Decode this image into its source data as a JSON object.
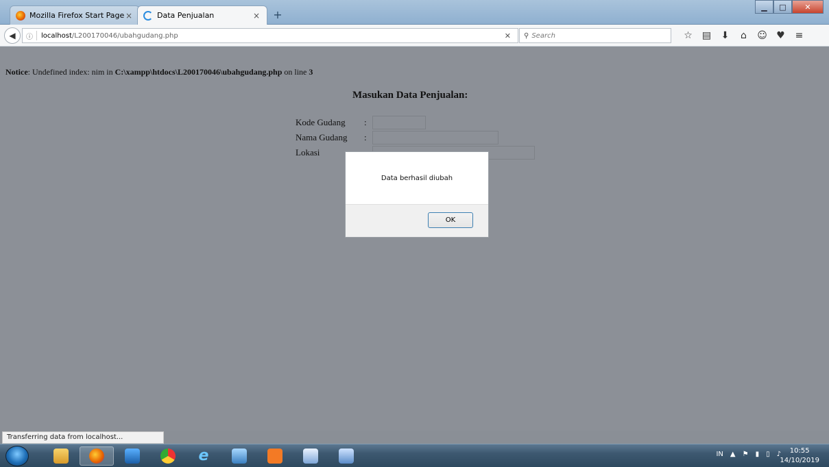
{
  "browser": {
    "tabs": [
      {
        "label": "Mozilla Firefox Start Page",
        "active": false
      },
      {
        "label": "Data Penjualan",
        "active": true
      }
    ],
    "new_tab_label": "+",
    "url": {
      "host": "localhost",
      "path": "/L200170046/ubahgudang.php"
    },
    "search_placeholder": "Search",
    "status_text": "Transferring data from localhost..."
  },
  "page": {
    "notice": {
      "label": "Notice",
      "text1": ": Undefined index: nim in ",
      "file": "C:\\xampp\\htdocs\\L200170046\\ubahgudang.php",
      "text2": " on line ",
      "line": "3"
    },
    "heading": "Masukan Data Penjualan:",
    "fields": [
      {
        "label": "Kode Gudang",
        "colon": ":",
        "value": ""
      },
      {
        "label": "Nama Gudang",
        "colon": ":",
        "value": ""
      },
      {
        "label": "Lokasi",
        "colon": "",
        "value": ""
      }
    ]
  },
  "dialog": {
    "message": "Data berhasil diubah",
    "ok_label": "OK"
  },
  "taskbar": {
    "language": "IN",
    "time": "10:55",
    "date": "14/10/2019"
  },
  "colors": {
    "page_bg": "#8c9097",
    "taskbar": "#3d5870",
    "accent": "#2a8ce0"
  }
}
